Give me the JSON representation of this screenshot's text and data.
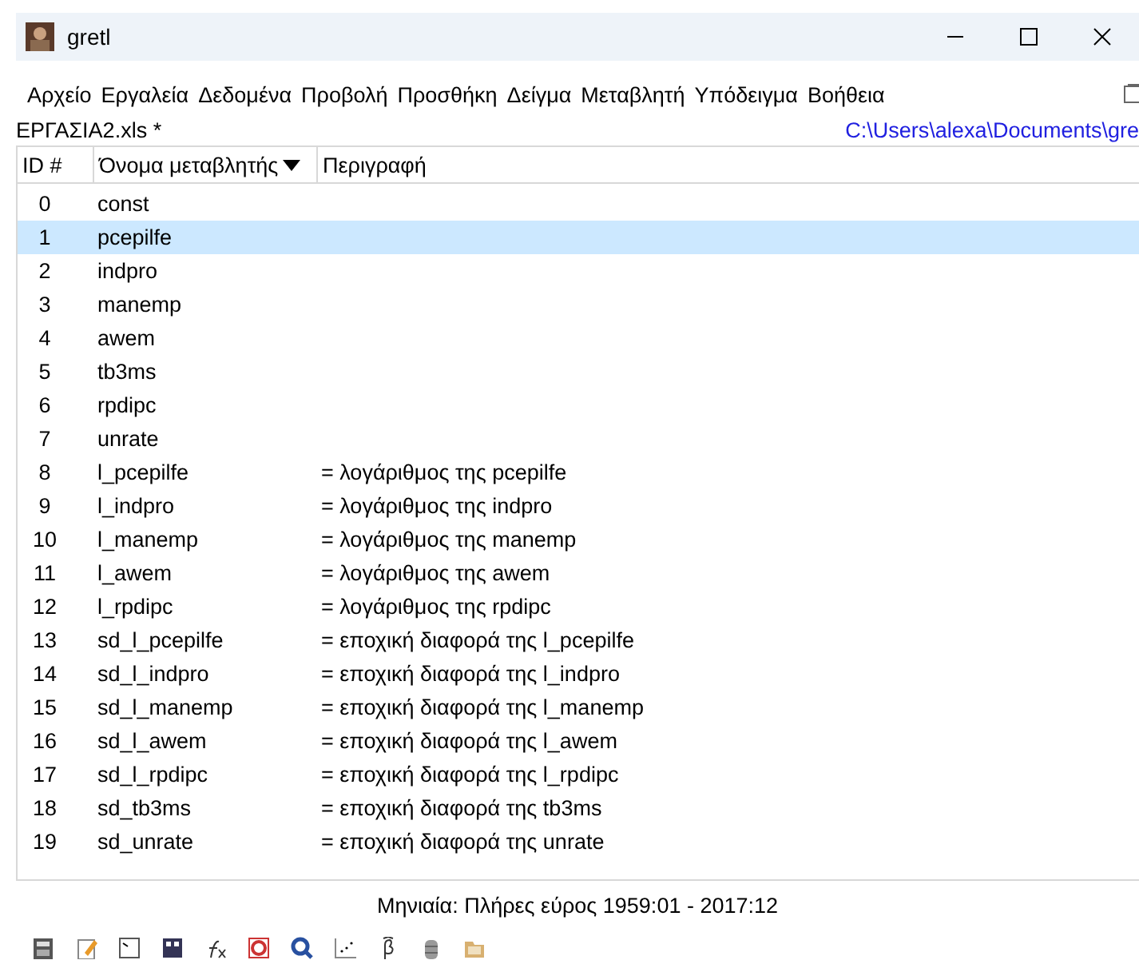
{
  "window": {
    "title": "gretl"
  },
  "menu": [
    "Αρχείο",
    "Εργαλεία",
    "Δεδομένα",
    "Προβολή",
    "Προσθήκη",
    "Δείγμα",
    "Μεταβλητή",
    "Υπόδειγμα",
    "Βοήθεια"
  ],
  "file": {
    "name": "ΕΡΓΑΣΙΑ2.xls *",
    "path": "C:\\Users\\alexa\\Documents\\gre"
  },
  "table": {
    "columns": [
      "ID #",
      "Όνομα μεταβλητής",
      "Περιγραφή"
    ],
    "rows": [
      {
        "id": "0",
        "name": "const",
        "description": "",
        "selected": false
      },
      {
        "id": "1",
        "name": "pcepilfe",
        "description": "",
        "selected": true
      },
      {
        "id": "2",
        "name": "indpro",
        "description": "",
        "selected": false
      },
      {
        "id": "3",
        "name": "manemp",
        "description": "",
        "selected": false
      },
      {
        "id": "4",
        "name": "awem",
        "description": "",
        "selected": false
      },
      {
        "id": "5",
        "name": "tb3ms",
        "description": "",
        "selected": false
      },
      {
        "id": "6",
        "name": "rpdipc",
        "description": "",
        "selected": false
      },
      {
        "id": "7",
        "name": "unrate",
        "description": "",
        "selected": false
      },
      {
        "id": "8",
        "name": "l_pcepilfe",
        "description": "= λογάριθμος της pcepilfe",
        "selected": false
      },
      {
        "id": "9",
        "name": "l_indpro",
        "description": "= λογάριθμος της indpro",
        "selected": false
      },
      {
        "id": "10",
        "name": "l_manemp",
        "description": "= λογάριθμος της manemp",
        "selected": false
      },
      {
        "id": "11",
        "name": "l_awem",
        "description": "= λογάριθμος της awem",
        "selected": false
      },
      {
        "id": "12",
        "name": "l_rpdipc",
        "description": "= λογάριθμος της rpdipc",
        "selected": false
      },
      {
        "id": "13",
        "name": "sd_l_pcepilfe",
        "description": "= εποχική διαφορά της l_pcepilfe",
        "selected": false
      },
      {
        "id": "14",
        "name": "sd_l_indpro",
        "description": "= εποχική διαφορά της l_indpro",
        "selected": false
      },
      {
        "id": "15",
        "name": "sd_l_manemp",
        "description": "= εποχική διαφορά της l_manemp",
        "selected": false
      },
      {
        "id": "16",
        "name": "sd_l_awem",
        "description": "= εποχική διαφορά της l_awem",
        "selected": false
      },
      {
        "id": "17",
        "name": "sd_l_rpdipc",
        "description": "= εποχική διαφορά της l_rpdipc",
        "selected": false
      },
      {
        "id": "18",
        "name": "sd_tb3ms",
        "description": "= εποχική διαφορά της tb3ms",
        "selected": false
      },
      {
        "id": "19",
        "name": "sd_unrate",
        "description": "= εποχική διαφορά της unrate",
        "selected": false
      }
    ]
  },
  "status_bar": "Μηνιαία: Πλήρες εύρος 1959:01 - 2017:12"
}
